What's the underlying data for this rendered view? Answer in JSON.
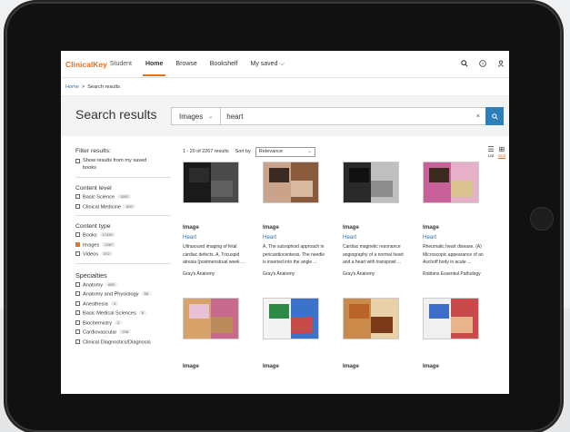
{
  "nav": {
    "brand": "ClinicalKey",
    "brand_sub": "Student",
    "items": [
      "Home",
      "Browse",
      "Bookshelf",
      "My saved"
    ],
    "my_saved_chevron": "⌵",
    "icons": [
      "search-icon",
      "help-icon",
      "user-icon"
    ]
  },
  "breadcrumb": {
    "home": "Home",
    "sep": ">",
    "current": "Search results"
  },
  "page_title": "Search results",
  "search": {
    "type": "Images",
    "query": "heart",
    "clear": "×"
  },
  "filters": {
    "title": "Filter results:",
    "show_my_books": "Show results from my saved books",
    "content_level": {
      "title": "Content level",
      "items": [
        {
          "label": "Basic Science",
          "count": "1591",
          "checked": false
        },
        {
          "label": "Clinical Medicine",
          "count": "629",
          "checked": false
        }
      ]
    },
    "content_type": {
      "title": "Content type",
      "items": [
        {
          "label": "Books",
          "count": "17430",
          "checked": false
        },
        {
          "label": "Images",
          "count": "2267",
          "checked": true
        },
        {
          "label": "Videos",
          "count": "372",
          "checked": false
        }
      ]
    },
    "specialties": {
      "title": "Specialties",
      "items": [
        {
          "label": "Anatomy",
          "count": "635"
        },
        {
          "label": "Anatomy and Physiology",
          "count": "58"
        },
        {
          "label": "Anesthesia",
          "count": "3"
        },
        {
          "label": "Basic Medical Sciences",
          "count": "8"
        },
        {
          "label": "Biochemistry",
          "count": "2"
        },
        {
          "label": "Cardiovascular",
          "count": "238"
        },
        {
          "label": "Clinical Diagnostics/Diagnosis",
          "count": ""
        }
      ]
    }
  },
  "results": {
    "summary": "1 - 20 of 2267 results",
    "sort_label": "Sort by",
    "sort_value": "Relevance",
    "view_list": "List",
    "view_grid": "Grid",
    "cards": [
      {
        "type": "Image",
        "title": "Heart",
        "desc": [
          "Ultrasound imaging of fetal",
          "cardiac defects. A, Tricuspid",
          "atresia (postmenstrual week ..."
        ],
        "source": "Gray's Anatomy"
      },
      {
        "type": "Image",
        "title": "Heart",
        "desc": [
          "A, The subxiphoid approach in",
          "pericardiocentesis. The needle",
          "is inserted into the angle ..."
        ],
        "source": "Gray's Anatomy"
      },
      {
        "type": "Image",
        "title": "Heart",
        "desc": [
          "Cardiac magnetic resonance",
          "angiography of a normal heart",
          "and a heart with transposit ..."
        ],
        "source": "Gray's Anatomy"
      },
      {
        "type": "Image",
        "title": "Heart",
        "desc": [
          "Rheumatic heart disease. (A)",
          "Microscopic appearance of an",
          "Aschoff body in acute ..."
        ],
        "source": "Robbins Essential Pathology"
      },
      {
        "type": "Image",
        "title": "",
        "desc": [],
        "source": ""
      },
      {
        "type": "Image",
        "title": "",
        "desc": [],
        "source": ""
      },
      {
        "type": "Image",
        "title": "",
        "desc": [],
        "source": ""
      },
      {
        "type": "Image",
        "title": "",
        "desc": [],
        "source": ""
      }
    ]
  },
  "colors": {
    "accent": "#e9711c",
    "link": "#2e6fa7",
    "search_button": "#2e7fb8"
  }
}
